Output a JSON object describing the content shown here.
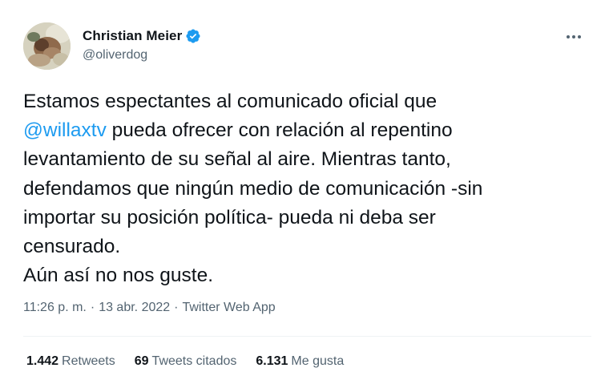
{
  "author": {
    "display_name": "Christian Meier",
    "handle": "@oliverdog",
    "verified": true
  },
  "tweet": {
    "text_before_mention": "Estamos espectantes al comunicado oficial que\n",
    "mention": "@willaxtv",
    "text_after_mention": " pueda ofrecer con relación al repentino\nlevantamiento de su señal al aire. Mientras tanto,\ndefendamos que ningún medio de comunicación -sin\nimportar su posición política- pueda ni deba ser\ncensurado.\nAún así no nos guste."
  },
  "meta": {
    "time": "11:26 p. m.",
    "separator": "·",
    "date": "13 abr. 2022",
    "source": "Twitter Web App"
  },
  "stats": {
    "retweets_count": "1.442",
    "retweets_label": "Retweets",
    "quotes_count": "69",
    "quotes_label": "Tweets citados",
    "likes_count": "6.131",
    "likes_label": "Me gusta"
  },
  "colors": {
    "accent": "#1d9bf0",
    "text": "#0f1419",
    "secondary": "#536471",
    "divider": "#eff3f4"
  },
  "icons": {
    "verified": "verified-badge-icon",
    "more": "more-options-icon"
  }
}
